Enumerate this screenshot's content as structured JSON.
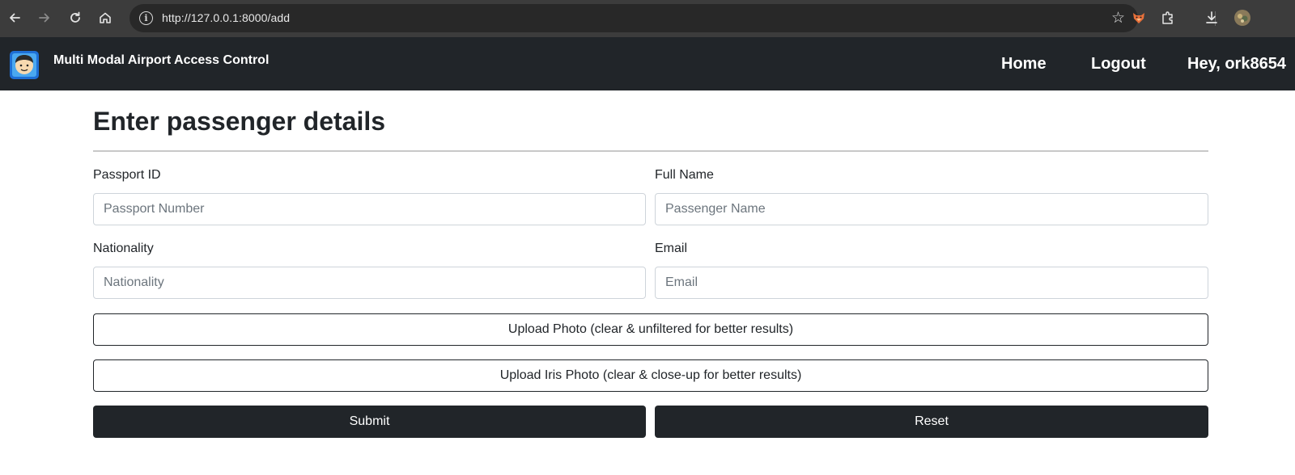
{
  "browser": {
    "url": "http://127.0.0.1:8000/add",
    "info_glyph": "i"
  },
  "icons": [
    "back-icon",
    "forward-icon",
    "reload-icon",
    "home-icon",
    "site-info-icon",
    "star-icon",
    "fox-extension-icon",
    "puzzle-extensions-icon",
    "download-icon",
    "profile-avatar-icon",
    "app-logo-icon"
  ],
  "navbar": {
    "brand": "Multi Modal Airport Access Control",
    "links": {
      "home": "Home",
      "logout": "Logout",
      "greeting": "Hey, ork8654"
    }
  },
  "form": {
    "title": "Enter passenger details",
    "passport": {
      "label": "Passport ID",
      "placeholder": "Passport Number",
      "value": ""
    },
    "full_name": {
      "label": "Full Name",
      "placeholder": "Passenger Name",
      "value": ""
    },
    "nationality": {
      "label": "Nationality",
      "placeholder": "Nationality",
      "value": ""
    },
    "email": {
      "label": "Email",
      "placeholder": "Email",
      "value": ""
    },
    "upload_photo": "Upload Photo (clear & unfiltered for better results)",
    "upload_iris": "Upload Iris Photo (clear & close-up for better results)",
    "submit": "Submit",
    "reset": "Reset"
  },
  "colors": {
    "navbar_bg": "#212529",
    "browser_bar_bg": "#3c3c3c",
    "button_dark": "#212529"
  }
}
